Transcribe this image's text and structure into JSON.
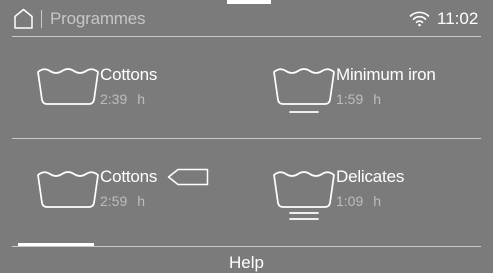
{
  "header": {
    "title": "Programmes",
    "time": "11:02",
    "icons": [
      "home-icon",
      "wifi-icon"
    ]
  },
  "programmes": [
    {
      "name": "Cottons",
      "duration": "2:39",
      "unit": "h",
      "icon": "wash-tub-icon"
    },
    {
      "name": "Minimum iron",
      "duration": "1:59",
      "unit": "h",
      "icon": "wash-tub-minimum-iron-icon"
    },
    {
      "name": "Cottons",
      "duration": "2:59",
      "unit": "h",
      "icon": "wash-tub-icon",
      "badge_icon": "tag-icon"
    },
    {
      "name": "Delicates",
      "duration": "1:09",
      "unit": "h",
      "icon": "wash-tub-delicates-icon"
    }
  ],
  "footer": {
    "help_label": "Help"
  },
  "colors": {
    "background": "#7b7b7b",
    "text": "#ffffff",
    "muted_text": "#bdbdbd",
    "divider": "#c9c9c9"
  }
}
